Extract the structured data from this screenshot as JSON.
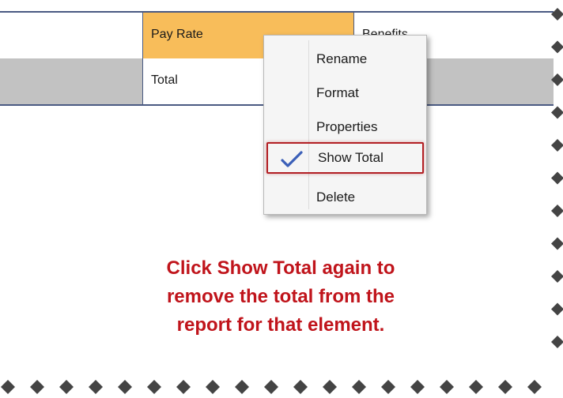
{
  "table": {
    "header": {
      "pay_rate": "Pay Rate",
      "benefits": "Benefits"
    },
    "row": {
      "total": "Total"
    }
  },
  "context_menu": {
    "items": [
      {
        "label": "Rename",
        "checked": false
      },
      {
        "label": "Format",
        "checked": false
      },
      {
        "label": "Properties",
        "checked": false
      },
      {
        "label": "Show Total",
        "checked": true
      },
      {
        "label": "Delete",
        "checked": false
      }
    ]
  },
  "callout": {
    "lines": [
      "Click Show Total again to",
      "remove the total from the",
      "report for that element."
    ]
  },
  "colors": {
    "header_highlight": "#f8bd5a",
    "grey_row": "#c2c2c2",
    "grid_border": "#4a5a82",
    "callout_text": "#c0141b",
    "selection_outline": "#b21f24",
    "checkmark": "#3b5fb8"
  },
  "icons": {
    "check": "checkmark-icon",
    "torn_edge": "diamond-edge-icon"
  }
}
